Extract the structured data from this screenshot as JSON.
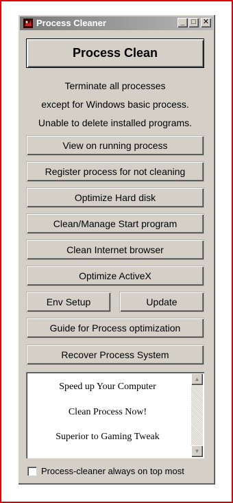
{
  "window": {
    "title": "Process Cleaner",
    "minimize_glyph": "_",
    "maximize_glyph": "□",
    "close_glyph": "✕"
  },
  "main": {
    "primary_button": "Process Clean",
    "description": [
      "Terminate all processes",
      "except for Windows basic process.",
      "Unable to delete installed programs."
    ],
    "buttons": [
      "View on running process",
      "Register process for not cleaning",
      "Optimize Hard disk",
      "Clean/Manage Start program",
      "Clean Internet browser",
      "Optimize ActiveX"
    ],
    "env_setup": "Env Setup",
    "update": "Update",
    "guide": "Guide for Process optimization",
    "recover": "Recover Process System"
  },
  "ad_box": {
    "lines": [
      "Speed up Your Computer",
      "Clean Process Now!",
      "Superior to Gaming Tweak"
    ],
    "scroll_up": "▲",
    "scroll_down": "▼"
  },
  "options": {
    "always_on_top_label": "Process-cleaner always on top most",
    "always_on_top_checked": false
  },
  "colors": {
    "frame": "#e00000",
    "window_bg": "#d4d0c8",
    "titlebar_inactive": "#7a7a7a"
  }
}
